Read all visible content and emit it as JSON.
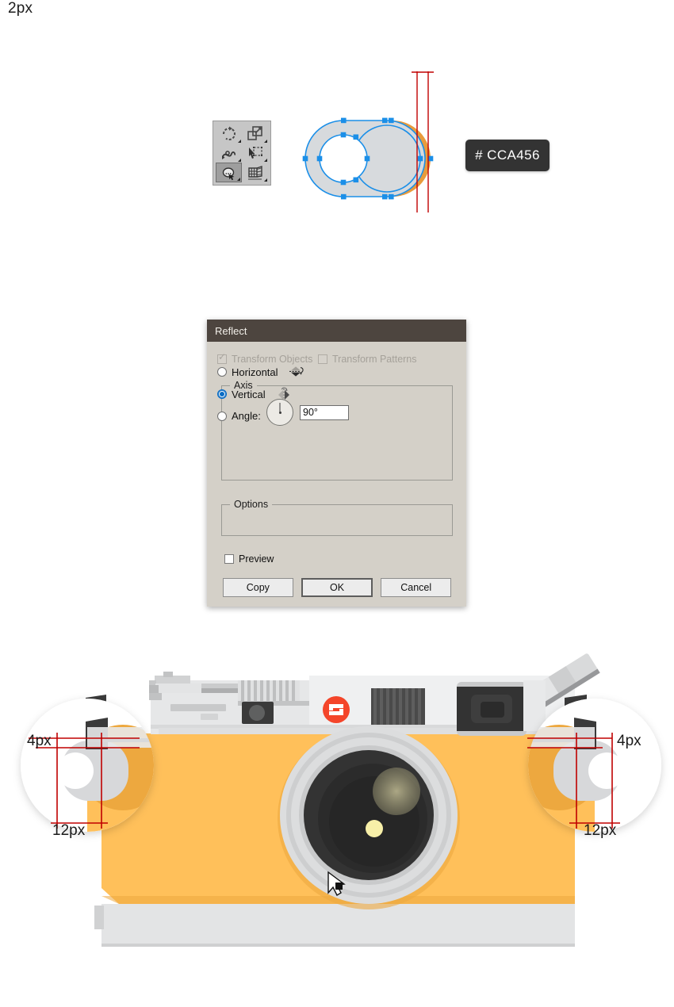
{
  "section_top": {
    "tool_palette": {
      "name": "illustrator-transform-tool-palette",
      "tools": [
        {
          "id": "rotate-tool",
          "icon": "rotate-icon",
          "selected": false
        },
        {
          "id": "scale-tool",
          "icon": "scale-icon",
          "selected": false
        },
        {
          "id": "reshape-tool",
          "icon": "reshape-icon",
          "selected": false
        },
        {
          "id": "free-transform-tool",
          "icon": "free-transform-icon",
          "selected": false
        },
        {
          "id": "shape-builder-tool",
          "icon": "shape-builder-icon",
          "selected": true
        },
        {
          "id": "perspective-grid-tool",
          "icon": "perspective-grid-icon",
          "selected": false
        }
      ]
    },
    "dimension_label": "2px",
    "hex_swatch": "# CCA456",
    "colors": {
      "orange_fill": "#E89B3C",
      "shape_fill": "#D7DADD",
      "selection_blue": "#1B8FE8",
      "guide_red": "#C00000",
      "swatch_bg": "#333333"
    }
  },
  "dialog": {
    "title": "Reflect",
    "axis": {
      "legend": "Axis",
      "options": [
        {
          "label": "Horizontal",
          "selected": false,
          "icon": "reflect-horizontal-icon"
        },
        {
          "label": "Vertical",
          "selected": true,
          "icon": "reflect-vertical-icon"
        }
      ],
      "angle_label": "Angle:",
      "angle_selected": false,
      "angle_value": "90°",
      "dial_icon": "angle-dial-icon"
    },
    "options": {
      "legend": "Options",
      "transform_objects": {
        "label": "Transform Objects",
        "checked": true,
        "disabled": true
      },
      "transform_patterns": {
        "label": "Transform Patterns",
        "checked": false,
        "disabled": true
      }
    },
    "preview": {
      "label": "Preview",
      "checked": false
    },
    "buttons": [
      {
        "label": "Copy",
        "default": false
      },
      {
        "label": "OK",
        "default": true
      },
      {
        "label": "Cancel",
        "default": false
      }
    ],
    "colors": {
      "titlebar": "#4D453F",
      "face": "#D4D0C8",
      "accent": "#0A6CC4"
    }
  },
  "camera": {
    "name": "flat-vector-camera-illustration",
    "logo_glyph": "S",
    "measurements": {
      "left": {
        "vertical": "4px",
        "horizontal": "12px"
      },
      "right": {
        "vertical": "4px",
        "horizontal": "12px"
      }
    },
    "colors": {
      "body_orange": "#FFC05A",
      "body_orange_dark": "#EDA83F",
      "top_plate": "#E6E7E8",
      "top_plate_light": "#EFF0F1",
      "bottom_plate": "#E3E4E5",
      "lens_ring_light": "#DCDDDE",
      "lens_ring_mid": "#C9CACB",
      "lens_dark": "#333333",
      "lens_darker": "#2B2B2B",
      "lens_inner": "#262626",
      "flare_big": "#9C9878",
      "flare_small": "#F7EFA8",
      "logo_red": "#F4452A",
      "knob_dark": "#3A3A3A",
      "guide_red": "#C00000",
      "magnifier_fill": "#FFFFFF"
    },
    "cursor": "arrow-cursor"
  }
}
